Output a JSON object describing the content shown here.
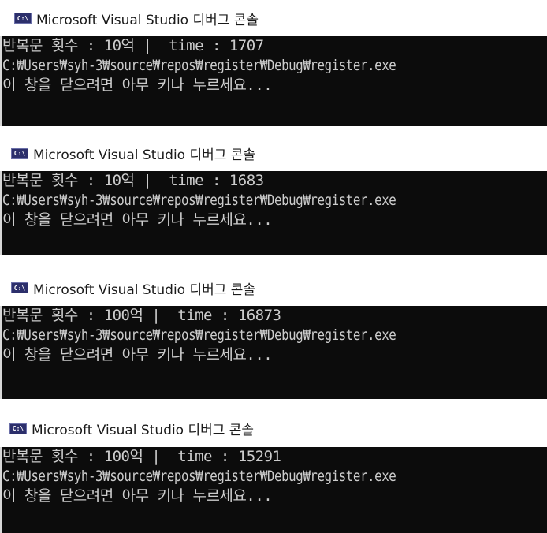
{
  "windows": [
    {
      "title": "Microsoft Visual Studio 디버그 콘솔",
      "icon_label": "C:\\",
      "lines": [
        "반복문 횟수 : 10억 |  time : 1707",
        "C:₩Users₩syh-3₩source₩repos₩register₩Debug₩register.exe",
        "이 창을 닫으려면 아무 키나 누르세요..."
      ]
    },
    {
      "title": "Microsoft Visual Studio 디버그 콘솔",
      "icon_label": "C:\\",
      "lines": [
        "반복문 횟수 : 10억 |  time : 1683",
        "C:₩Users₩syh-3₩source₩repos₩register₩Debug₩register.exe",
        "이 창을 닫으려면 아무 키나 누르세요..."
      ]
    },
    {
      "title": "Microsoft Visual Studio 디버그 콘솔",
      "icon_label": "C:\\",
      "lines": [
        "반복문 횟수 : 100억 |  time : 16873",
        "C:₩Users₩syh-3₩source₩repos₩register₩Debug₩register.exe",
        "이 창을 닫으려면 아무 키나 누르세요..."
      ]
    },
    {
      "title": "Microsoft Visual Studio 디버그 콘솔",
      "icon_label": "C:\\",
      "lines": [
        "반복문 횟수 : 100억 |  time : 15291",
        "C:₩Users₩syh-3₩source₩repos₩register₩Debug₩register.exe",
        "이 창을 닫으려면 아무 키나 누르세요..."
      ]
    }
  ],
  "colors": {
    "console_bg": "#0c0c0c",
    "console_text": "#cccccc",
    "title_text": "#1a1a1a",
    "icon_bg": "#2c2f6b"
  }
}
